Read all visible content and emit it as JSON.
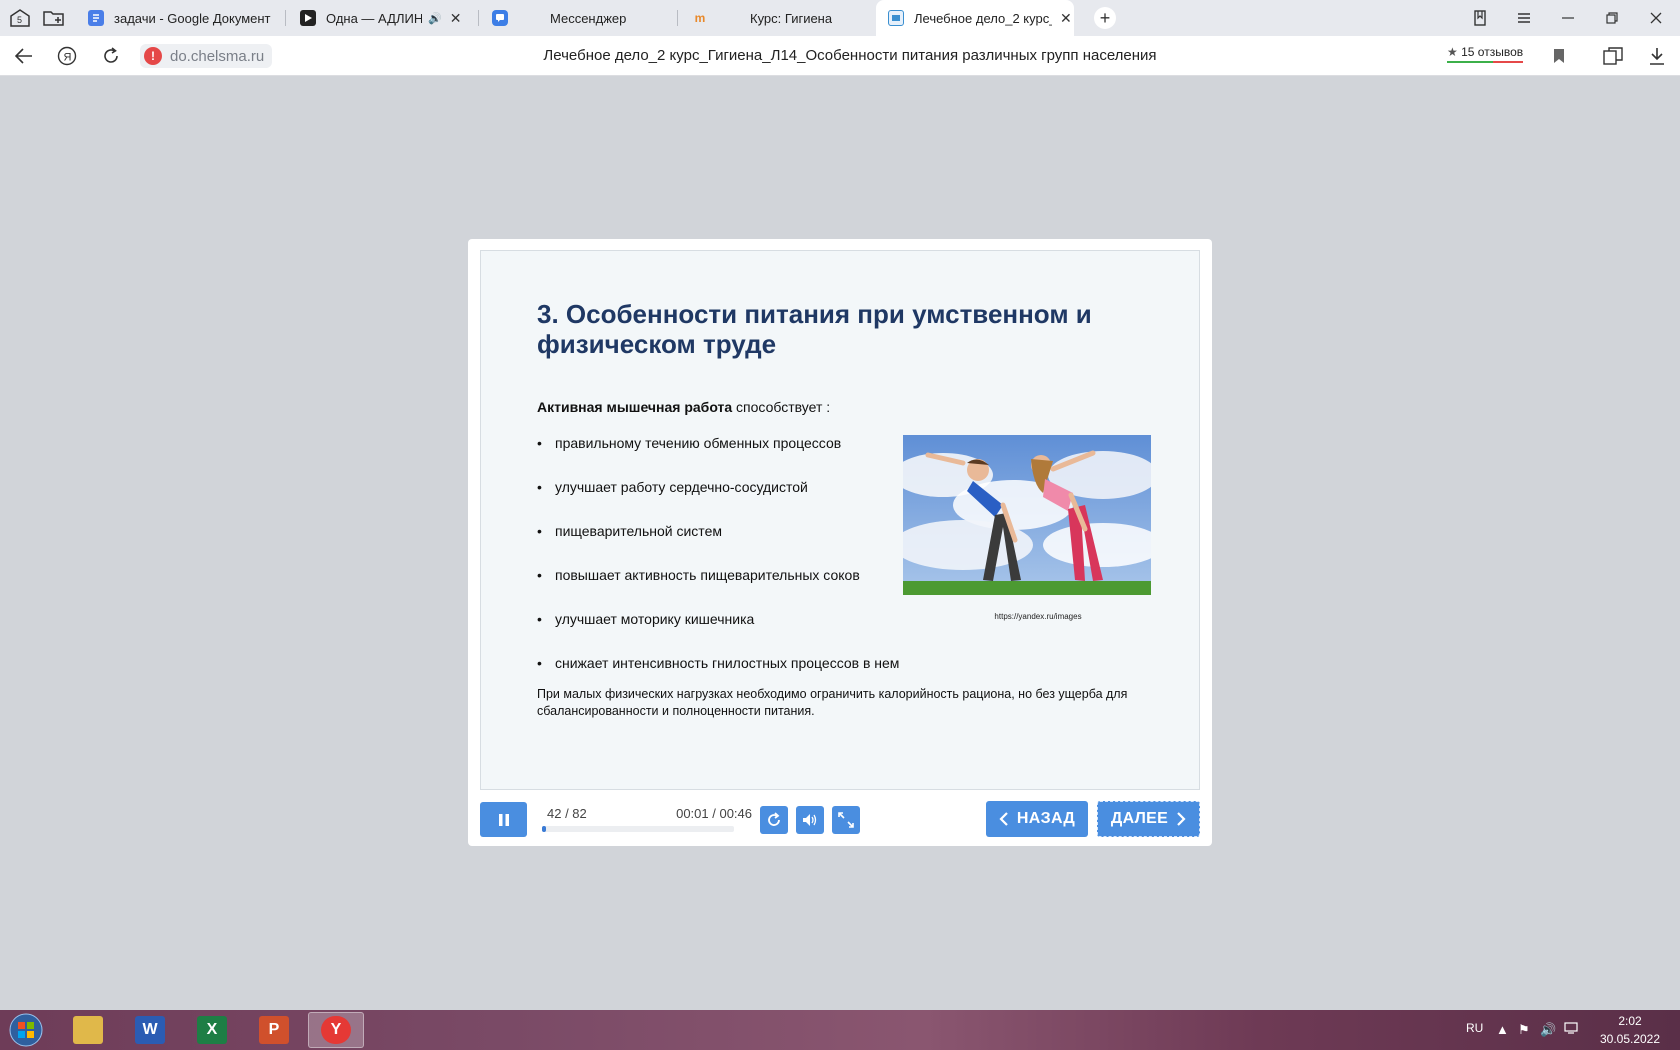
{
  "browser": {
    "tabs": [
      {
        "title": "задачи - Google Документ",
        "icon": "google-docs-icon",
        "color": "#4a7ee8"
      },
      {
        "title": "Одна — АДЛИН, Ки",
        "icon": "youtube-play-icon",
        "color": "#222222",
        "audio": "🔊"
      },
      {
        "title": "Мессенджер",
        "icon": "messenger-icon",
        "color": "#3d7ee6"
      },
      {
        "title": "Курс: Гигиена",
        "icon": "moodle-icon",
        "color": "#e8892b"
      },
      {
        "title": "Лечебное дело_2 курс_",
        "icon": "course-page-icon",
        "color": "#3a8fd0"
      }
    ],
    "close_glyph": "✕",
    "new_tab_glyph": "+",
    "address": {
      "url": "do.chelsma.ru",
      "warning": "!",
      "page_title": "Лечебное дело_2 курс_Гигиена_Л14_Особенности питания различных групп населения",
      "reviews": "15 отзывов",
      "reviews_star": "★"
    }
  },
  "slide": {
    "title": "3. Особенности питания при умственном и физическом труде",
    "lead_bold": "Активная мышечная работа",
    "lead_rest": " способствует :",
    "bullets": [
      "правильному течению обменных процессов",
      "улучшает работу сердечно-сосудистой",
      "пищеварительной систем",
      "повышает активность пищеварительных соков",
      "улучшает моторику кишечника",
      "снижает интенсивность гнилостных процессов в нем"
    ],
    "image_caption": "https://yandex.ru/images",
    "note": "При малых физических нагрузках необходимо ограничить калорийность рациона, но без ущерба для сбалансированности и полноценности питания."
  },
  "player": {
    "counter": "42 / 82",
    "time": "00:01 / 00:46",
    "progress_fraction": 0.02,
    "back_label": "НАЗАД",
    "next_label": "ДАЛЕЕ",
    "accent": "#4a8ee0"
  },
  "taskbar": {
    "apps": [
      {
        "name": "explorer",
        "letter": "",
        "color": "#e0b84a"
      },
      {
        "name": "word",
        "letter": "W",
        "color": "#2b5cb3"
      },
      {
        "name": "excel",
        "letter": "X",
        "color": "#1e7e45"
      },
      {
        "name": "powerpoint",
        "letter": "P",
        "color": "#d0502c"
      },
      {
        "name": "yandex-browser",
        "letter": "Y",
        "color": "#e53935"
      }
    ],
    "lang": "RU",
    "time": "2:02",
    "date": "30.05.2022"
  }
}
